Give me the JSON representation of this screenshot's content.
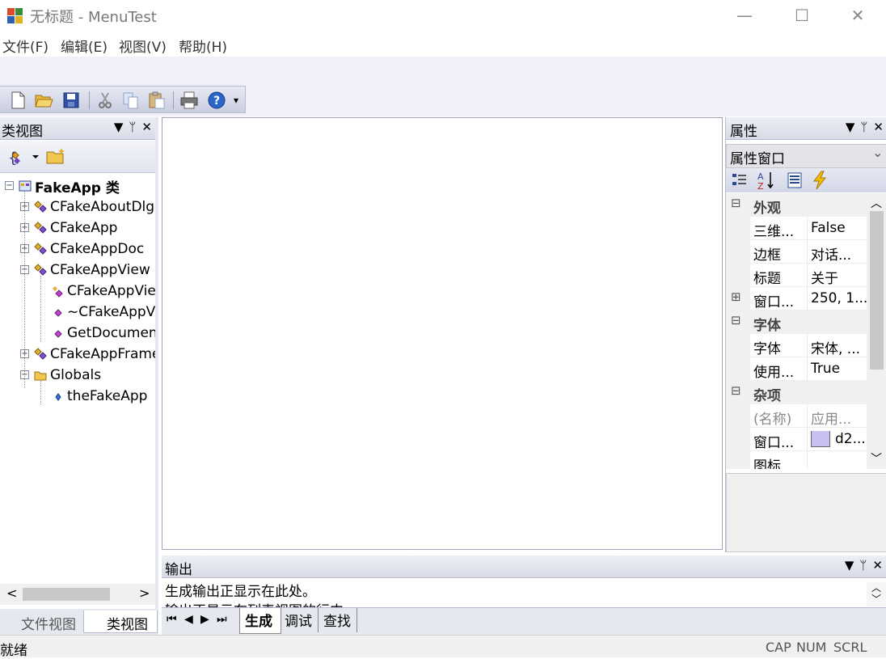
{
  "window": {
    "title": "无标题 - MenuTest",
    "minimize": "—",
    "maximize": "☐",
    "close": "✕"
  },
  "menu": [
    "文件(F)",
    "编辑(E)",
    "视图(V)",
    "帮助(H)"
  ],
  "toolbar": {
    "buttons": [
      "new-icon",
      "open-icon",
      "save-icon",
      "cut-icon",
      "copy-icon",
      "paste-icon",
      "print-icon",
      "help-icon"
    ],
    "overflow": "▾"
  },
  "class_view": {
    "title": "类视图",
    "header_icons": {
      "dropdown": "▼",
      "pin": "ᛘ",
      "close": "✕"
    },
    "tree": [
      {
        "label": "FakeApp 类",
        "bold": true,
        "expanded": true
      },
      {
        "label": "CFakeAboutDlg"
      },
      {
        "label": "CFakeApp"
      },
      {
        "label": "CFakeAppDoc"
      },
      {
        "label": "CFakeAppView",
        "expanded": true
      },
      {
        "label": "CFakeAppView()"
      },
      {
        "label": "~CFakeAppView()"
      },
      {
        "label": "GetDocument()"
      },
      {
        "label": "CFakeAppFrame"
      },
      {
        "label": "Globals",
        "expanded": true
      },
      {
        "label": "theFakeApp"
      }
    ],
    "scroll_left": "<",
    "scroll_right": ">",
    "tabs": [
      {
        "label": "文件视图",
        "active": false
      },
      {
        "label": "类视图",
        "active": true
      }
    ]
  },
  "properties": {
    "title": "属性",
    "header_icons": {
      "dropdown": "▼",
      "pin": "ᛘ",
      "close": "✕"
    },
    "combo": "属性窗口",
    "combo_arrow": "⌄",
    "rows": [
      {
        "type": "category",
        "name": "外观",
        "toggle": "⊟"
      },
      {
        "type": "prop",
        "name": "三维...",
        "value": "False"
      },
      {
        "type": "prop",
        "name": "边框",
        "value": "对话..."
      },
      {
        "type": "prop",
        "name": "标题",
        "value": "关于"
      },
      {
        "type": "prop",
        "name": "窗口...",
        "value": "250, 1...",
        "toggle": "⊞"
      },
      {
        "type": "category",
        "name": "字体",
        "toggle": "⊟"
      },
      {
        "type": "prop",
        "name": "字体",
        "value": "宋体, ..."
      },
      {
        "type": "prop",
        "name": "使用...",
        "value": "True"
      },
      {
        "type": "category",
        "name": "杂项",
        "toggle": "⊟"
      },
      {
        "type": "prop",
        "name": "(名称)",
        "value": "应用...",
        "dim": true
      },
      {
        "type": "prop",
        "name": "窗口...",
        "value": "d2...",
        "swatch": "#c8c0f0"
      },
      {
        "type": "prop",
        "name": "图标",
        "value": ""
      }
    ],
    "scroll_up": "︿",
    "scroll_down": "﹀"
  },
  "output": {
    "title": "输出",
    "header_icons": {
      "dropdown": "▼",
      "pin": "ᛘ",
      "close": "✕"
    },
    "lines": [
      "生成输出正显示在此处。",
      "输出正显示在列表视图的行中"
    ],
    "nav": [
      "⏮",
      "◀",
      "▶",
      "⏭"
    ],
    "tabs": [
      {
        "label": "生成",
        "active": true
      },
      {
        "label": "调试",
        "active": false
      },
      {
        "label": "查找",
        "active": false
      }
    ]
  },
  "status": {
    "text": "就绪",
    "indicators": [
      "CAP",
      "NUM",
      "SCRL"
    ]
  },
  "colors": {
    "accent": "#3c6eb4",
    "pane_header": "#d8dbe6",
    "status_bg": "#f0f0f0"
  }
}
